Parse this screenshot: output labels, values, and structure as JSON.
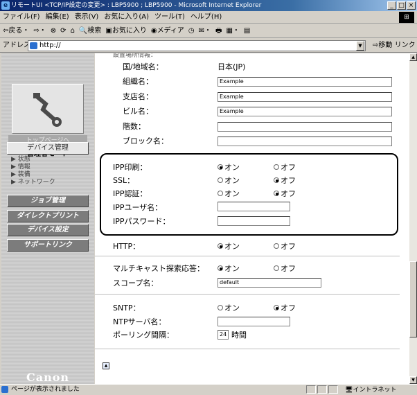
{
  "window": {
    "title": "リモートUI <TCP/IP設定の変更> : LBP5900 ; LBP5900 - Microsoft Internet Explorer",
    "buttons": [
      "_",
      "□",
      "×"
    ]
  },
  "menubar": {
    "items": [
      "ファイル(F)",
      "編集(E)",
      "表示(V)",
      "お気に入り(A)",
      "ツール(T)",
      "ヘルプ(H)"
    ]
  },
  "toolbar": {
    "back": "⇦戻る・",
    "forward": "⇨・",
    "stop": "⊗",
    "refresh": "⟳",
    "home": "⌂",
    "search": "検索",
    "favorites": "お気に入り",
    "media": "メディア",
    "history": "◷",
    "mail": "✉・",
    "print": "🖶",
    "edit": "▦・",
    "discuss": "▤"
  },
  "address": {
    "label": "アドレス(D)",
    "value": "http://",
    "go_label": "移動",
    "links_label": "リンク"
  },
  "leftnav": {
    "top_page": "トップページへ",
    "mode": "管理者モード",
    "device_manage": "デバイス管理",
    "sublinks": [
      "▶ 状態",
      "▶ 情報",
      "▶ 装備",
      "▶ ネットワーク"
    ],
    "job_manage": "ジョブ管理",
    "direct_print": "ダイレクトプリント",
    "device_settings": "デバイス設定",
    "support_link": "サポートリンク",
    "brand": "Canon"
  },
  "content": {
    "section_header": "設置場所情報：",
    "country_label": "国/地域名：",
    "country_value": "日本(JP)",
    "org_label": "組織名：",
    "org_value": "Example",
    "branch_label": "支店名：",
    "branch_value": "Example",
    "building_label": "ビル名：",
    "building_value": "Example",
    "floor_label": "階数：",
    "floor_value": "",
    "block_label": "ブロック名：",
    "block_value": "",
    "ipp_print_label": "IPP印刷：",
    "ssl_label": "SSL：",
    "ipp_auth_label": "IPP認証：",
    "ipp_user_label": "IPPユーザ名：",
    "ipp_user_value": "",
    "ipp_pass_label": "IPPパスワード：",
    "ipp_pass_value": "",
    "http_label": "HTTP：",
    "multicast_label": "マルチキャスト探索応答：",
    "scope_label": "スコープ名：",
    "scope_value": "default",
    "sntp_label": "SNTP：",
    "ntp_label": "NTPサーバ名：",
    "ntp_value": "",
    "polling_label": "ポーリング間隔：",
    "polling_value": "24",
    "polling_unit": "時間",
    "on": "オン",
    "off": "オフ",
    "settings": {
      "ipp_print": "on",
      "ssl": "off",
      "ipp_auth": "off",
      "http": "on",
      "multicast": "on",
      "sntp": "off"
    }
  },
  "status": {
    "text": "ページが表示されました",
    "zone": "イントラネット"
  }
}
